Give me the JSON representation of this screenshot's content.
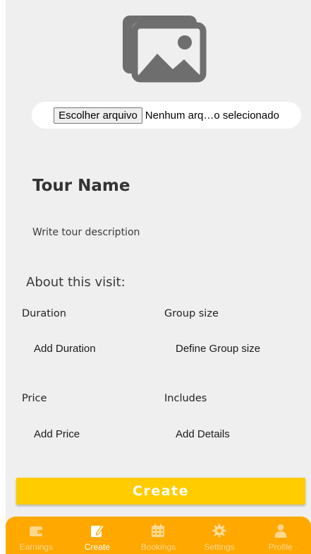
{
  "upload": {
    "button_label": "Escolher arquivo",
    "status_text": "Nenhum arq…o selecionado",
    "icon": "image-gallery-icon"
  },
  "tour": {
    "name": "Tour Name",
    "description": "Write tour description"
  },
  "about": {
    "heading": "About this visit:",
    "duration_label": "Duration",
    "duration_value": "Add Duration",
    "group_label": "Group size",
    "group_value": "Define Group size",
    "price_label": "Price",
    "price_value": "Add Price",
    "includes_label": "Includes",
    "includes_value": "Add Details"
  },
  "actions": {
    "create_label": "Create"
  },
  "nav": {
    "items": [
      {
        "label": "Earnings",
        "icon": "wallet-icon",
        "active": false
      },
      {
        "label": "Create",
        "icon": "edit-icon",
        "active": true
      },
      {
        "label": "Bookings",
        "icon": "calendar-icon",
        "active": false
      },
      {
        "label": "Settings",
        "icon": "gear-icon",
        "active": false
      },
      {
        "label": "Profile",
        "icon": "user-icon",
        "active": false
      }
    ]
  },
  "colors": {
    "accent": "#ffcc00",
    "nav_background": "#ffa800",
    "background": "#efefef"
  }
}
